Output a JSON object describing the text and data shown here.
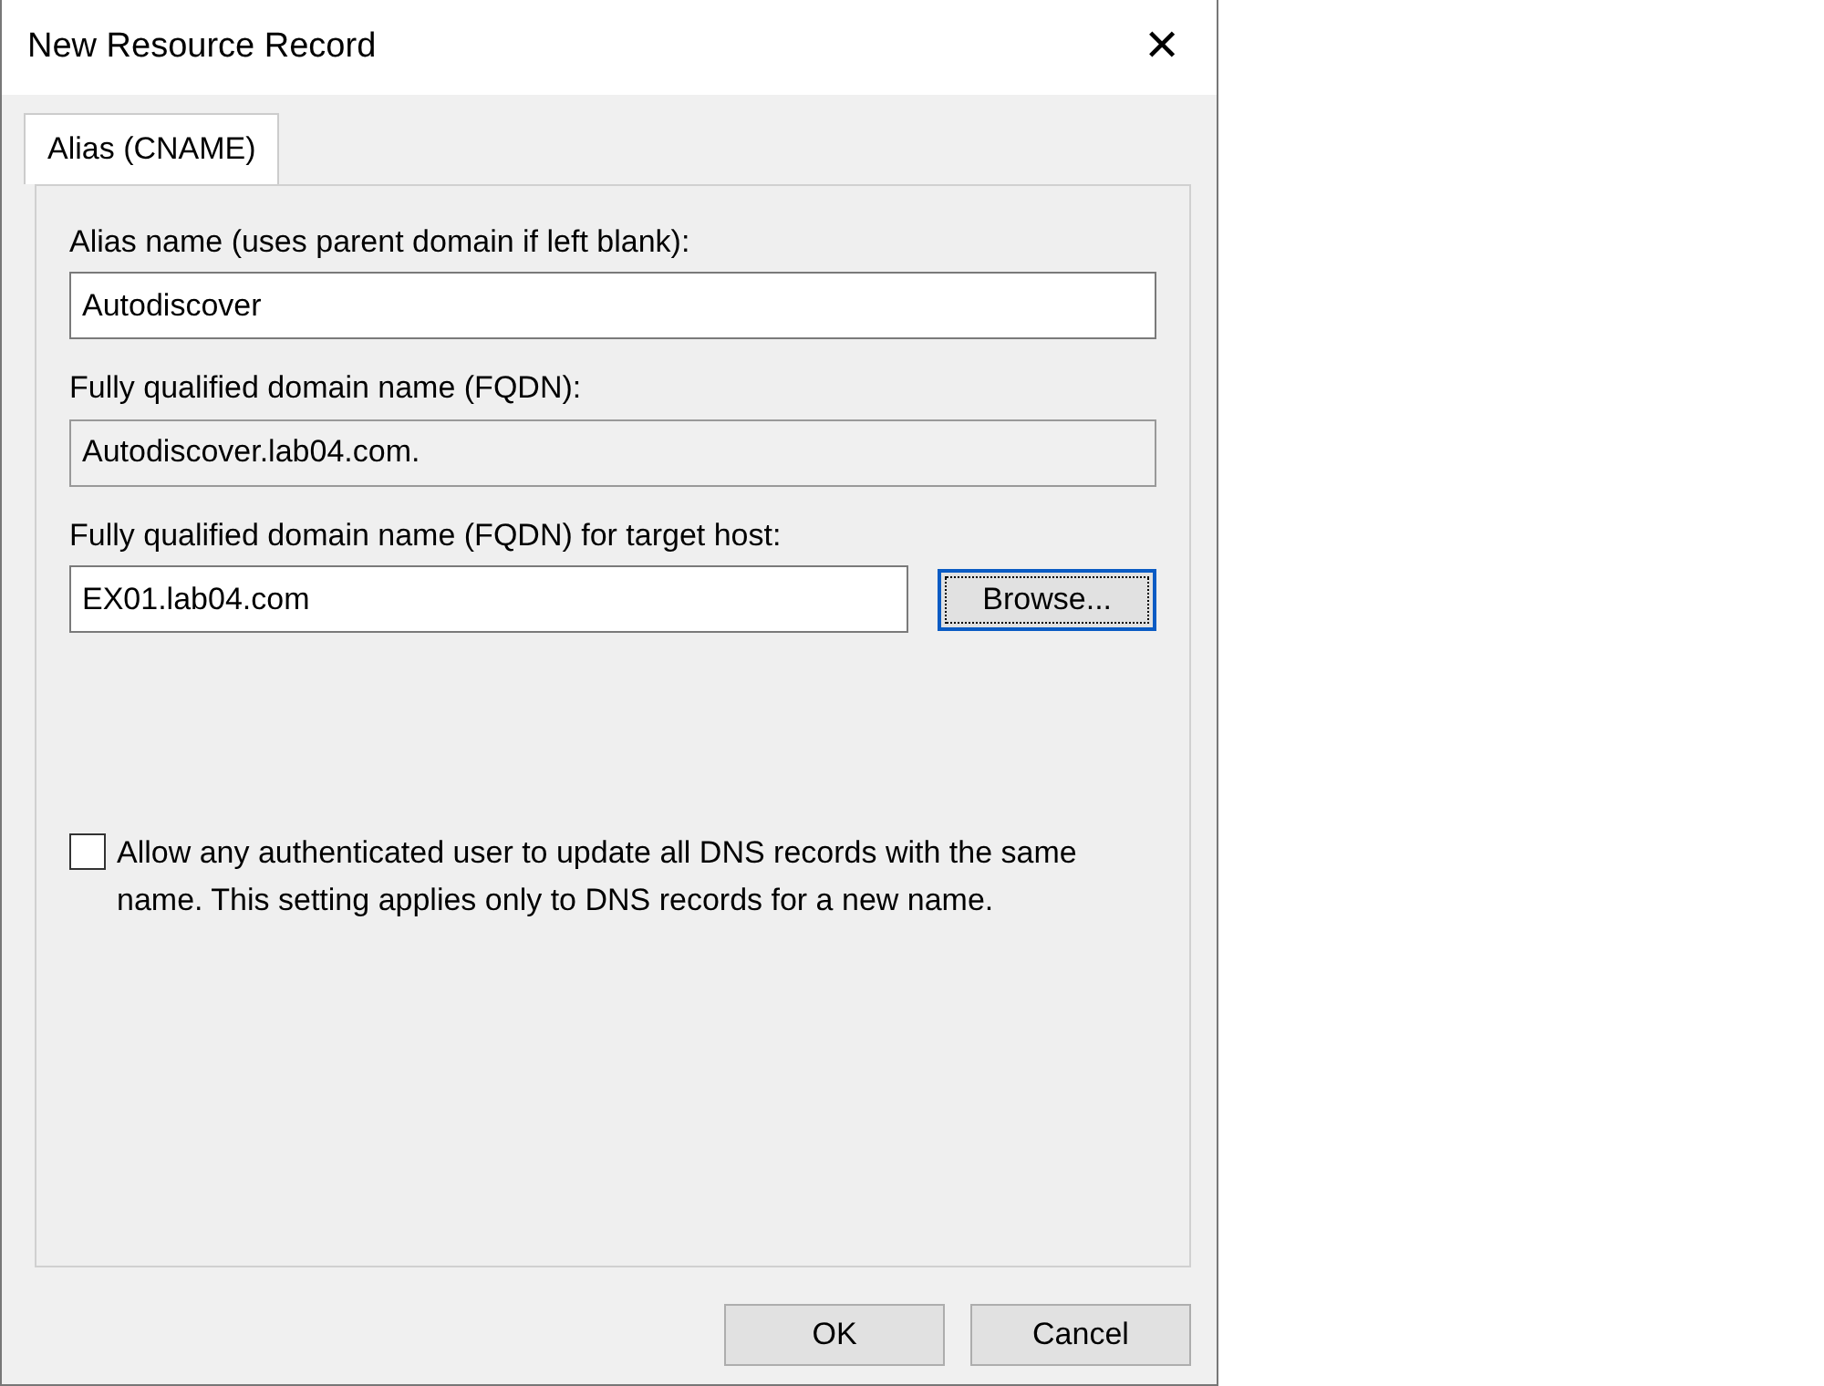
{
  "window": {
    "title": "New Resource Record",
    "close": "✕"
  },
  "tabs": [
    {
      "label": "Alias (CNAME)",
      "selected": true
    }
  ],
  "fields": [
    {
      "label": "Alias name (uses parent domain if left blank):",
      "value": "Autodiscover",
      "readonly": false
    },
    {
      "label": "Fully qualified domain name (FQDN):",
      "value": "Autodiscover.lab04.com.",
      "readonly": true
    },
    {
      "label": "Fully qualified domain name (FQDN) for target host:",
      "value": "EX01.lab04.com",
      "readonly": false,
      "button": "Browse..."
    }
  ],
  "checkbox": {
    "label": "Allow any authenticated user to update all DNS records with the same name. This setting applies only to DNS records for a new name.",
    "checked": false
  },
  "buttons": [
    "OK",
    "Cancel"
  ]
}
